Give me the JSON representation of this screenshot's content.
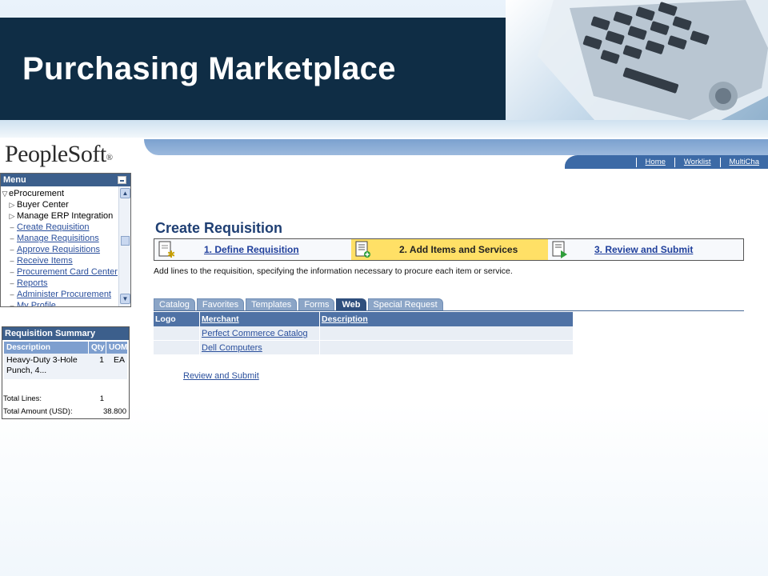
{
  "slide": {
    "title": "Purchasing Marketplace"
  },
  "app": {
    "logo_text": "PeopleSoft",
    "logo_mark": "®"
  },
  "top_nav": {
    "home": "Home",
    "worklist": "Worklist",
    "multichannel": "MultiCha"
  },
  "menu": {
    "header": "Menu",
    "items": [
      {
        "label": "eProcurement",
        "prefix": "▽"
      },
      {
        "label": "Buyer Center",
        "prefix": "▷"
      },
      {
        "label": "Manage ERP Integration",
        "prefix": "▷"
      },
      {
        "label": "Create Requisition",
        "prefix": "–"
      },
      {
        "label": "Manage Requisitions",
        "prefix": "–"
      },
      {
        "label": "Approve Requisitions",
        "prefix": "–"
      },
      {
        "label": "Receive Items",
        "prefix": "–"
      },
      {
        "label": "Procurement Card Center",
        "prefix": "–"
      },
      {
        "label": "Reports",
        "prefix": "–"
      },
      {
        "label": "Administer Procurement",
        "prefix": "–"
      },
      {
        "label": "My Profile",
        "prefix": "–"
      }
    ]
  },
  "summary": {
    "title": "Requisition Summary",
    "columns": {
      "description": "Description",
      "qty": "Qty",
      "uom": "UOM"
    },
    "row": {
      "description": "Heavy-Duty 3-Hole Punch, 4...",
      "qty": "1",
      "uom": "EA"
    },
    "total_lines_label": "Total Lines:",
    "total_lines_value": "1",
    "total_amount_label": "Total Amount (USD):",
    "total_amount_value": "38.800"
  },
  "main": {
    "title": "Create Requisition",
    "steps": [
      {
        "label": "1. Define Requisition"
      },
      {
        "label": "2. Add Items and Services"
      },
      {
        "label": "3. Review and Submit"
      }
    ],
    "instructions": "Add lines to the requisition, specifying the information necessary to procure each item or service.",
    "tabs": [
      "Catalog",
      "Favorites",
      "Templates",
      "Forms",
      "Web",
      "Special Request"
    ],
    "active_tab": "Web",
    "grid": {
      "headers": {
        "logo": "Logo",
        "merchant": "Merchant",
        "description": "Description"
      },
      "rows": [
        {
          "logo": "",
          "merchant": "Perfect Commerce Catalog",
          "description": ""
        },
        {
          "logo": "",
          "merchant": "Dell Computers",
          "description": ""
        }
      ]
    },
    "review_link": "Review and Submit"
  },
  "colors": {
    "banner_dark": "#0f2d45",
    "header_blue": "#3c5f8c",
    "link_blue": "#2a4f9c",
    "active_step": "#ffe066",
    "title_blue": "#1f3f73"
  }
}
